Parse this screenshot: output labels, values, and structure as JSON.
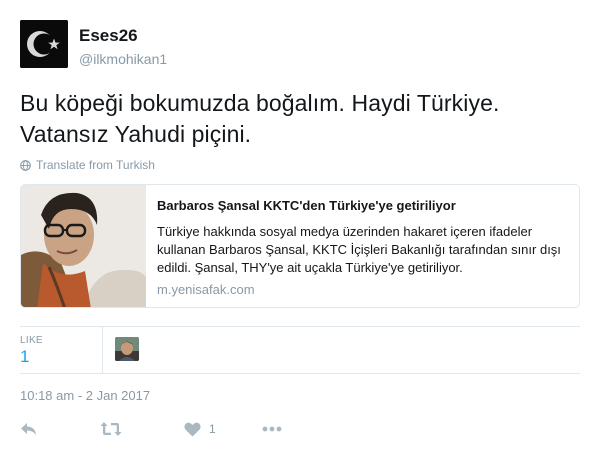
{
  "user": {
    "name": "Eses26",
    "handle": "@ilkmohikan1"
  },
  "tweet": {
    "text_line1": "Bu köpeği bokumuzda boğalım. Haydi Türkiye.",
    "text_line2": "Vatansız Yahudi piçini.",
    "translate_label": "Translate from Turkish"
  },
  "card": {
    "title": "Barbaros Şansal KKTC'den Türkiye'ye getiriliyor",
    "description": "Türkiye hakkında sosyal medya üzerinden hakaret içeren ifadeler kullanan Barbaros Şansal, KKTC İçişleri Bakanlığı tarafından sınır dışı edildi. Şansal, THY'ye ait uçakla Türkiye'ye getiriliyor.",
    "domain": "m.yenisafak.com"
  },
  "stats": {
    "like_label": "LIKE",
    "like_count": "1"
  },
  "timestamp": "10:18 am - 2 Jan 2017",
  "actions": {
    "like_count": "1",
    "icons": [
      "reply-icon",
      "retweet-icon",
      "heart-icon",
      "more-icon"
    ]
  },
  "colors": {
    "accent": "#1da1f2",
    "muted": "#8899a6",
    "border": "#e1e8ed",
    "text": "#14171a"
  }
}
